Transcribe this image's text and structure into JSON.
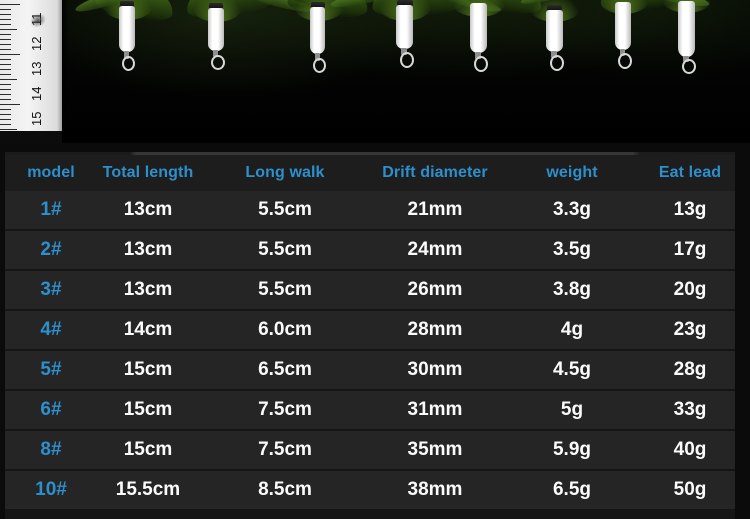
{
  "photo": {
    "alt": "fishing-lure-floats-with-ruler",
    "ruler": {
      "unit_marks": [
        "11",
        "12",
        "13",
        "14",
        "15"
      ]
    },
    "lure_count": 8
  },
  "table": {
    "headers": [
      "model",
      "Total length",
      "Long walk",
      "Drift diameter",
      "weight",
      "Eat lead"
    ],
    "rows": [
      {
        "model": "1#",
        "total_length": "13cm",
        "long_walk": "5.5cm",
        "drift_diameter": "21mm",
        "weight": "3.3g",
        "eat_lead": "13g"
      },
      {
        "model": "2#",
        "total_length": "13cm",
        "long_walk": "5.5cm",
        "drift_diameter": "24mm",
        "weight": "3.5g",
        "eat_lead": "17g"
      },
      {
        "model": "3#",
        "total_length": "13cm",
        "long_walk": "5.5cm",
        "drift_diameter": "26mm",
        "weight": "3.8g",
        "eat_lead": "20g"
      },
      {
        "model": "4#",
        "total_length": "14cm",
        "long_walk": "6.0cm",
        "drift_diameter": "28mm",
        "weight": "4g",
        "eat_lead": "23g"
      },
      {
        "model": "5#",
        "total_length": "15cm",
        "long_walk": "6.5cm",
        "drift_diameter": "30mm",
        "weight": "4.5g",
        "eat_lead": "28g"
      },
      {
        "model": "6#",
        "total_length": "15cm",
        "long_walk": "7.5cm",
        "drift_diameter": "31mm",
        "weight": "5g",
        "eat_lead": "33g"
      },
      {
        "model": "8#",
        "total_length": "15cm",
        "long_walk": "7.5cm",
        "drift_diameter": "35mm",
        "weight": "5.9g",
        "eat_lead": "40g"
      },
      {
        "model": "10#",
        "total_length": "15.5cm",
        "long_walk": "8.5cm",
        "drift_diameter": "38mm",
        "weight": "6.5g",
        "eat_lead": "50g"
      }
    ]
  },
  "colors": {
    "accent_blue": "#2d8fcc",
    "row_background": "#252525",
    "header_background": "#1d1d1d",
    "value_text": "#fbfbfb",
    "page_background": "#0b0b0b"
  }
}
